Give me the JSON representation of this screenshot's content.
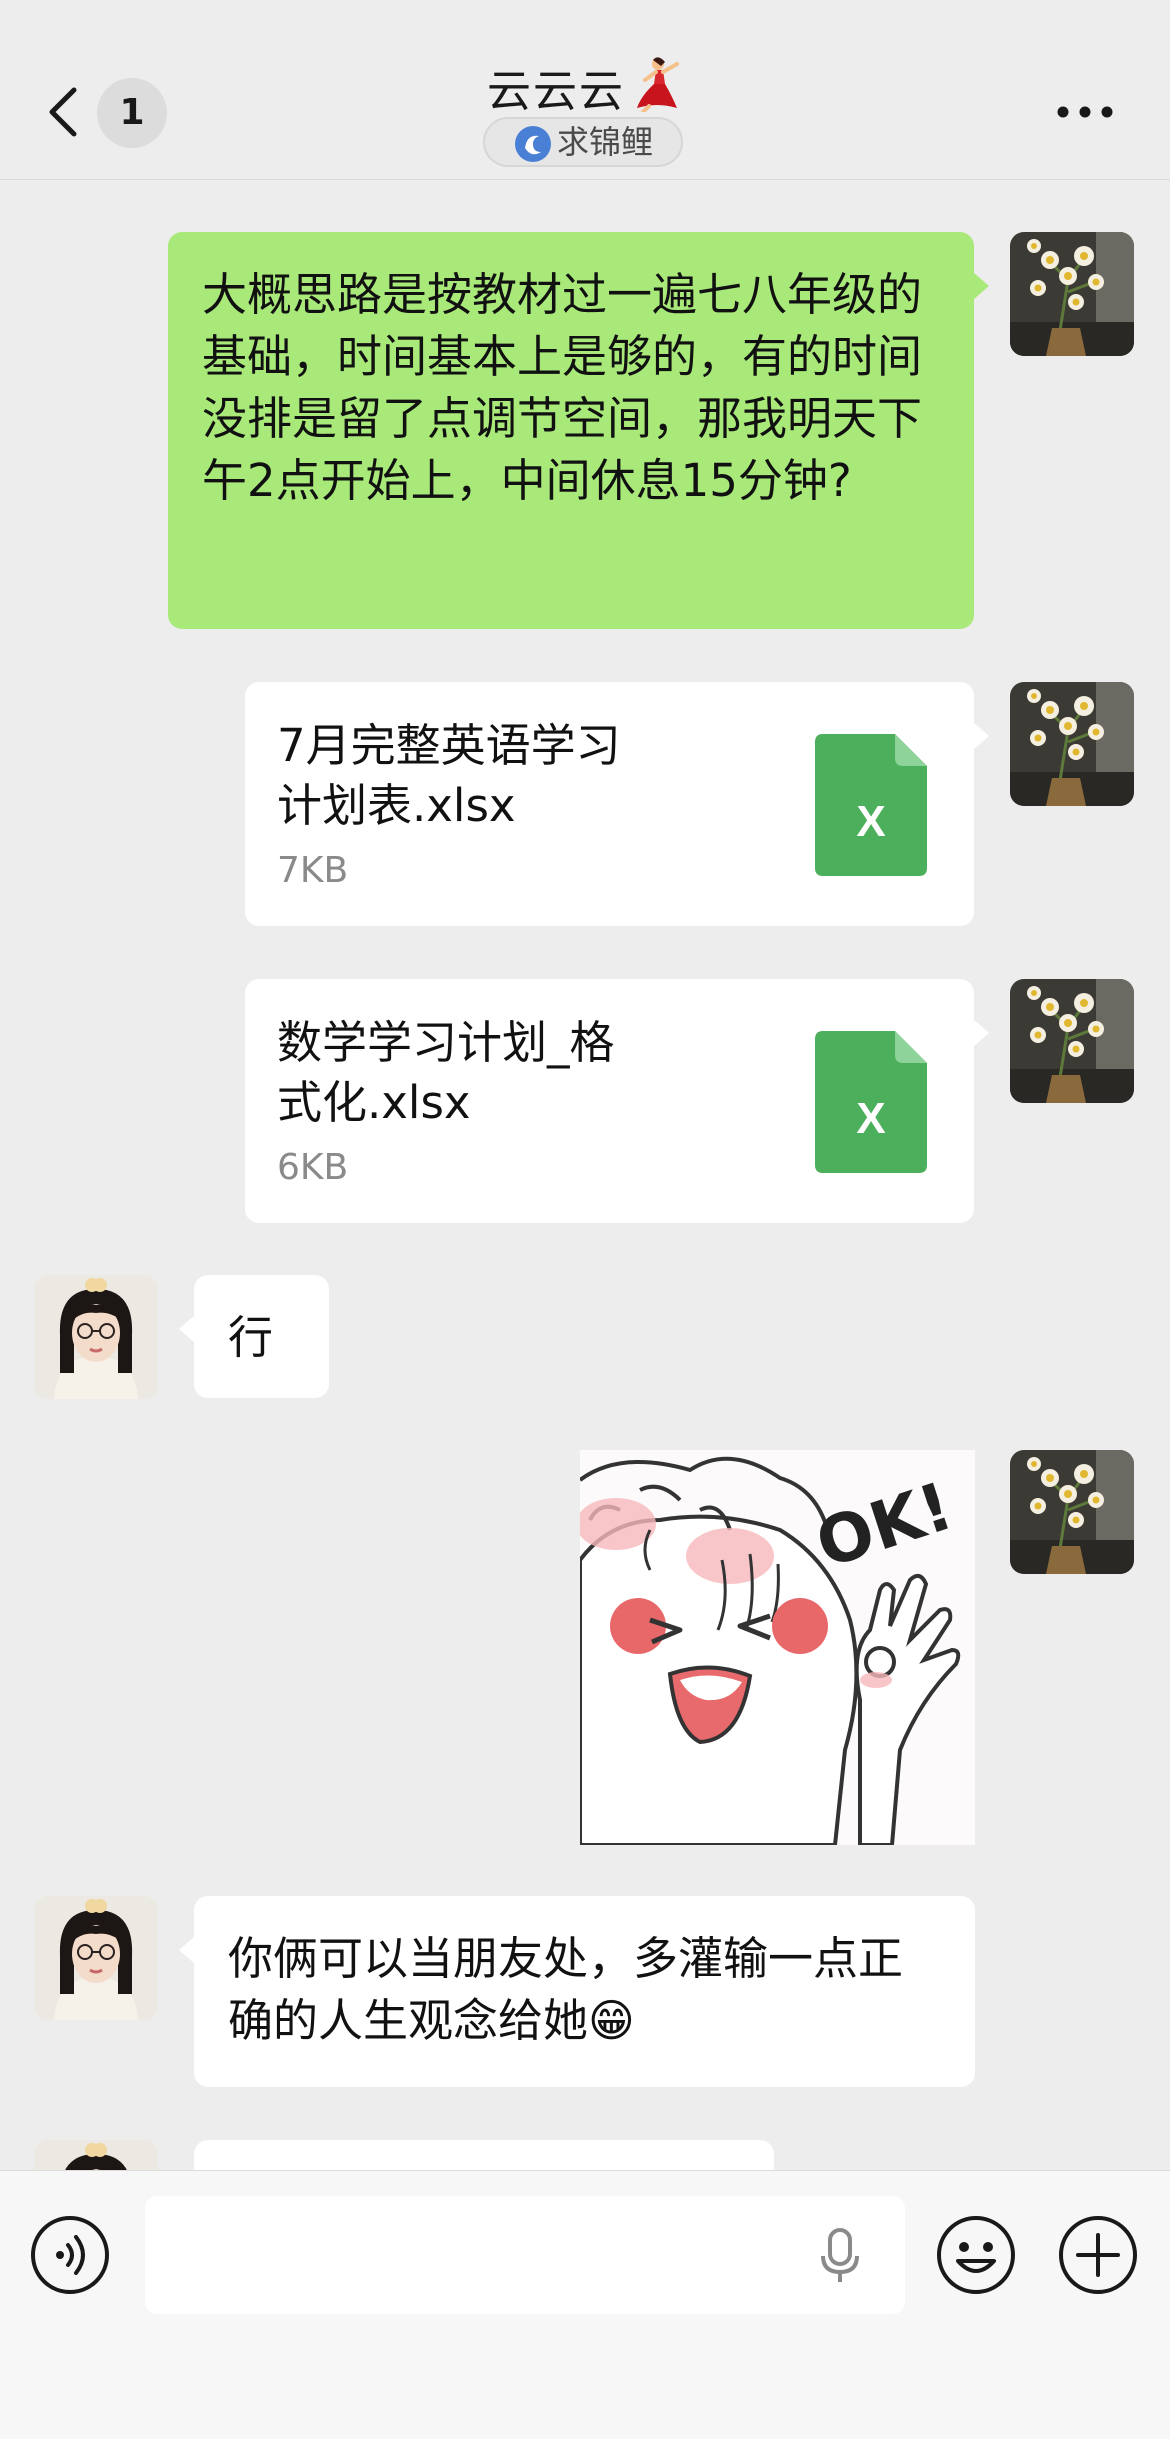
{
  "header": {
    "back_icon": "chevron-left-icon",
    "unread_count": "1",
    "title": "云云云",
    "status_label": "求锦鲤",
    "more_icon": "more-dots-icon"
  },
  "messages": [
    {
      "side": "right",
      "type": "text",
      "text": "大概思路是按教材过一遍七八年级的基础，时间基本上是够的，有的时间没排是留了点调节空间，那我明天下午2点开始上，中间休息15分钟?"
    },
    {
      "side": "right",
      "type": "file",
      "file_name": "7月完整英语学习计划表.xlsx",
      "file_size": "7KB",
      "file_icon_letter": "X"
    },
    {
      "side": "right",
      "type": "file",
      "file_name": "数学学习计划_格式化.xlsx",
      "file_size": "6KB",
      "file_icon_letter": "X"
    },
    {
      "side": "left",
      "type": "text",
      "text": "行"
    },
    {
      "side": "right",
      "type": "sticker",
      "sticker_text": "OK!"
    },
    {
      "side": "left",
      "type": "text",
      "text": "你俩可以当朋友处，多灌输一点正确的人生观念给她😁"
    }
  ],
  "input_bar": {
    "voice_icon": "voice-mode-icon",
    "placeholder": "",
    "mic_icon": "microphone-icon",
    "emoji_icon": "emoji-icon",
    "plus_icon": "plus-icon"
  },
  "colors": {
    "background": "#ededed",
    "outgoing_bubble": "#a9e97a",
    "incoming_bubble": "#ffffff",
    "excel_green": "#4caf5c"
  }
}
